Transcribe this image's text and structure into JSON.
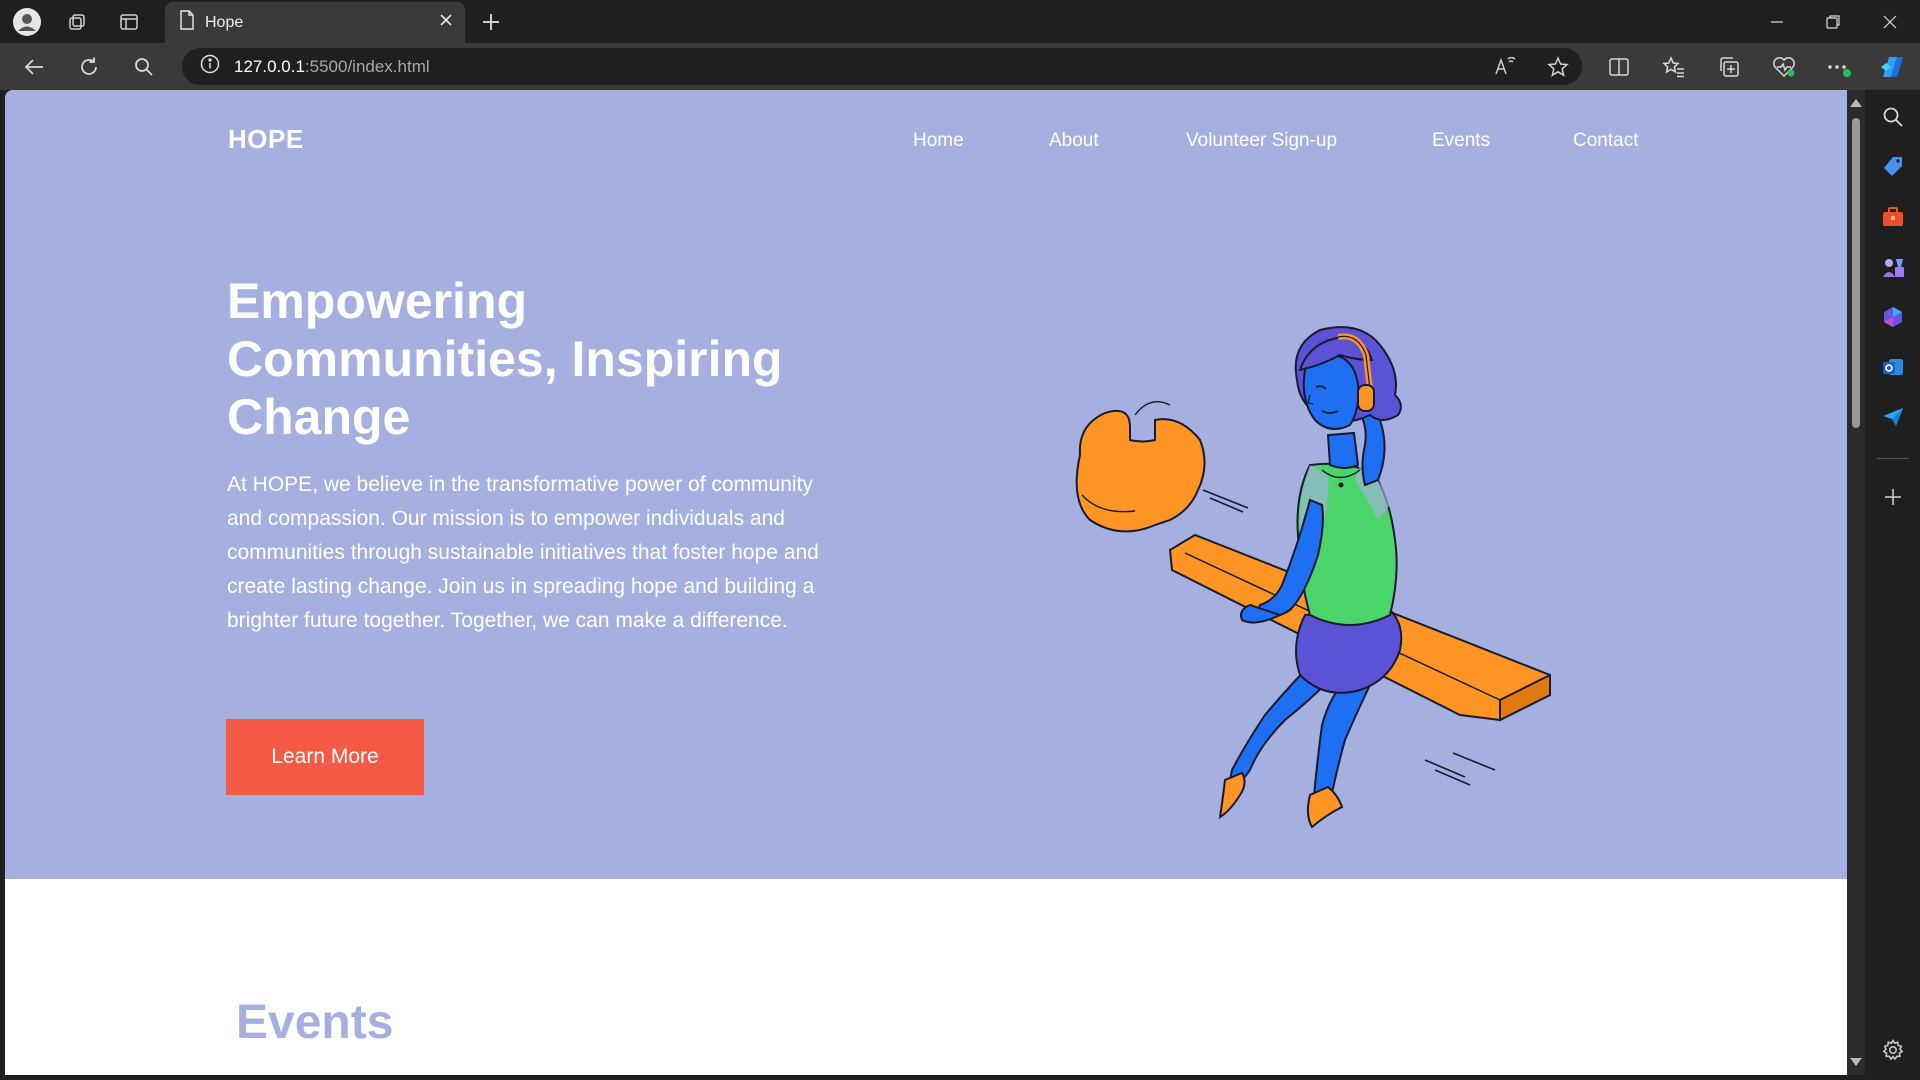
{
  "browser": {
    "tab_title": "Hope",
    "url_host": "127.0.0.1",
    "url_rest": ":5500/index.html"
  },
  "site": {
    "logo": "HOPE",
    "nav": [
      "Home",
      "About",
      "Volunteer Sign-up",
      "Events",
      "Contact"
    ]
  },
  "hero": {
    "title": "Empowering Communities, Inspiring Change",
    "body": "At HOPE, we believe in the transformative power of community and compassion. Our mission is to empower individuals and communities through sustainable initiatives that foster hope and create lasting change. Join us in spreading hope and building a brighter future together. Together, we can make a difference.",
    "cta_label": "Learn More"
  },
  "events": {
    "title": "Events"
  },
  "colors": {
    "hero_bg": "#a5b0e0",
    "cta": "#f45a45",
    "wrench": "#ff9524",
    "figure_skin": "#1f6ff2",
    "figure_shirt": "#4bd46a",
    "figure_skirt": "#5b52d6"
  }
}
